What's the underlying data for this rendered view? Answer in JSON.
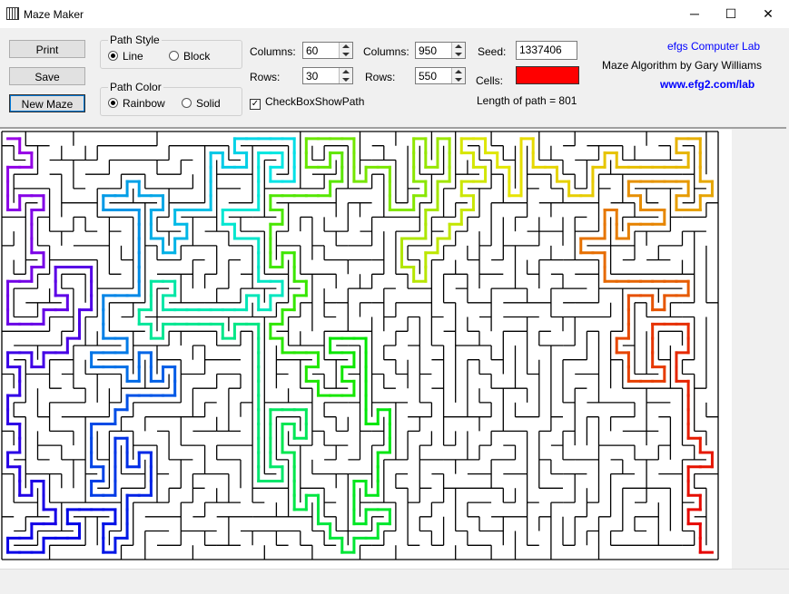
{
  "window": {
    "title": "Maze Maker",
    "icon": "maze-app-icon",
    "minimize": "─",
    "maximize": "☐",
    "close": "✕"
  },
  "buttons": {
    "print": "Print",
    "save": "Save",
    "new_maze": "New Maze"
  },
  "path_style": {
    "title": "Path Style",
    "options": [
      "Line",
      "Block"
    ],
    "selected": "Line"
  },
  "path_color": {
    "title": "Path Color",
    "options": [
      "Rainbow",
      "Solid"
    ],
    "selected": "Rainbow"
  },
  "grid": {
    "columns_label": "Columns:",
    "columns_value": "60",
    "rows_label": "Rows:",
    "rows_value": "30"
  },
  "size": {
    "columns_label": "Columns:",
    "columns_value": "950",
    "rows_label": "Rows:",
    "rows_value": "550"
  },
  "seed": {
    "label": "Seed:",
    "value": "1337406"
  },
  "cells": {
    "label": "Cells:",
    "color": "#ff0000"
  },
  "checkbox": {
    "label": "CheckBoxShowPath",
    "checked": true,
    "mark": "✓"
  },
  "path_length": "Length of path = 801",
  "credits": {
    "lab": "efgs Computer Lab",
    "author": "Maze Algorithm by Gary Williams",
    "url": "www.efg2.com/lab",
    "color": "#0000ff"
  },
  "maze": {
    "columns": 60,
    "rows": 30,
    "seed": 1337406,
    "wall_color": "#000000",
    "background": "#ffffff"
  }
}
